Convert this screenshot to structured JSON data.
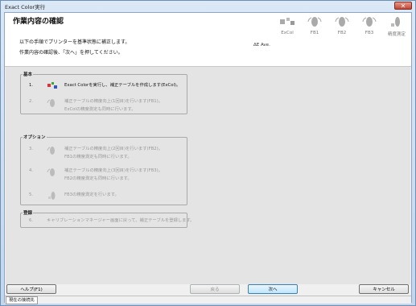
{
  "window": {
    "title": "Exact Color実行",
    "close_label": "✕"
  },
  "header": {
    "page_title": "作業内容の確認",
    "desc1": "以下の手順でプリンターを基準状態に補正します。",
    "desc2": "作業内容の確認後、「次へ」を押してください。",
    "delta_e": "ΔE Ave.",
    "steps": [
      {
        "label": "ExCol",
        "icon": "excol-icon"
      },
      {
        "label": "FB1",
        "icon": "fb1-icon"
      },
      {
        "label": "FB2",
        "icon": "fb2-icon"
      },
      {
        "label": "FB3",
        "icon": "fb3-icon"
      },
      {
        "label": "精度測定",
        "icon": "measure-icon"
      }
    ]
  },
  "groups": {
    "basic": {
      "label": "基本",
      "rows": [
        {
          "num": "1.",
          "line1": "Exact Colorを実行し、補正テーブルを作成します(ExCol)。",
          "line2": ""
        },
        {
          "num": "2.",
          "line1": "補正テーブルの精度向上(1回目)を行います(FB1)。",
          "line2": "ExColの精度測定も同時に行います。"
        }
      ]
    },
    "option": {
      "label": "オプション",
      "rows": [
        {
          "num": "3.",
          "line1": "補正テーブルの精度向上(2回目)を行います(FB2)。",
          "line2": "FB1の精度測定も同時に行います。"
        },
        {
          "num": "4.",
          "line1": "補正テーブルの精度向上(3回目)を行います(FB3)。",
          "line2": "FB2の精度測定も同時に行います。"
        },
        {
          "num": "5.",
          "line1": "FB3の精度測定を行います。",
          "line2": ""
        }
      ]
    },
    "register": {
      "label": "登録",
      "rows": [
        {
          "num": "6.",
          "line1": "キャリブレーションマネージャー画面に戻って、補正テーブルを登録します。",
          "line2": ""
        }
      ]
    }
  },
  "buttons": {
    "help": "ヘルプ(F1)",
    "back": "戻る",
    "next": "次へ",
    "cancel": "キャンセル"
  },
  "status": {
    "text": "現在の接続先"
  }
}
